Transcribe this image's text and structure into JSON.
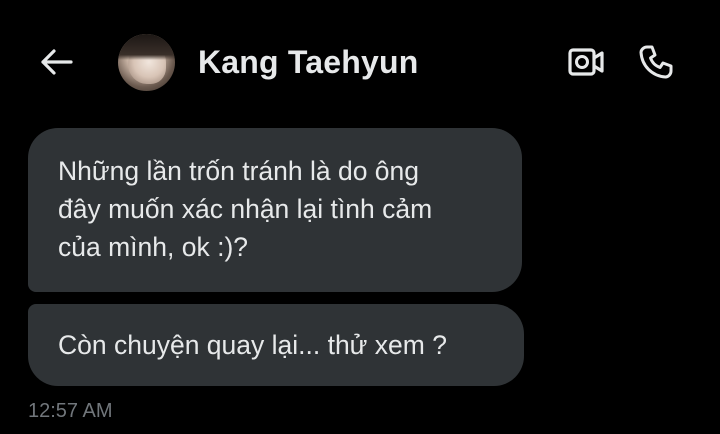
{
  "header": {
    "contact_name": "Kang Taehyun",
    "back_icon": "arrow-left",
    "video_icon": "video-camera",
    "call_icon": "phone"
  },
  "messages": [
    {
      "lines": [
        "Những lần trốn tránh là do ông",
        "đây muốn xác nhận lại tình cảm",
        "của mình, ok :)?"
      ]
    },
    {
      "lines": [
        "Còn chuyện quay lại... thử xem ?"
      ]
    }
  ],
  "timestamp": "12:57 AM",
  "colors": {
    "background": "#000000",
    "bubble": "#2f3336",
    "text": "#e7e9ea",
    "muted": "#71767b"
  }
}
